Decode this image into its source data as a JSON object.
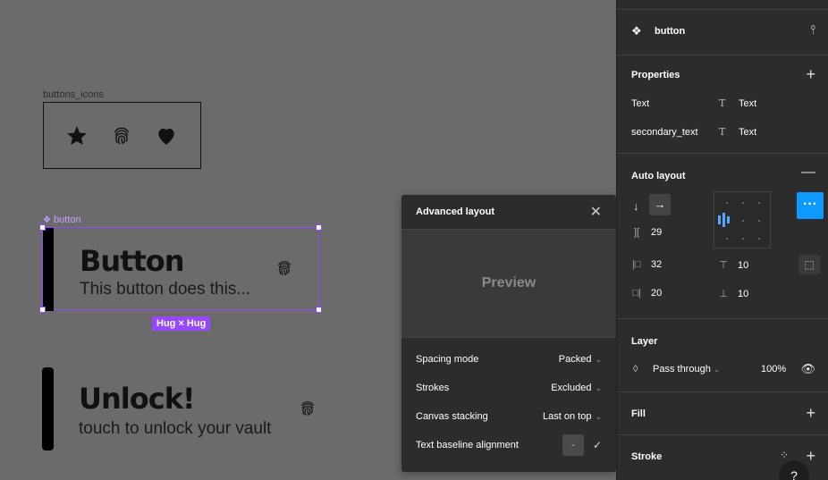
{
  "canvas": {
    "frame_label": "buttons_icons",
    "component_label": "button",
    "button_title": "Button",
    "button_subtitle": "This button does this...",
    "hug_badge": "Hug × Hug",
    "unlock_title": "Unlock!",
    "unlock_subtitle": "touch to unlock your vault"
  },
  "advanced_layout": {
    "title": "Advanced layout",
    "preview": "Preview",
    "rows": [
      {
        "label": "Spacing mode",
        "value": "Packed"
      },
      {
        "label": "Strokes",
        "value": "Excluded"
      },
      {
        "label": "Canvas stacking",
        "value": "Last on top"
      },
      {
        "label": "Text baseline alignment",
        "value": "-"
      }
    ]
  },
  "panel": {
    "component_name": "button",
    "properties": {
      "title": "Properties",
      "items": [
        {
          "name": "Text",
          "value": "Text"
        },
        {
          "name": "secondary_text",
          "value": "Text"
        }
      ]
    },
    "auto_layout": {
      "title": "Auto layout",
      "gap": "29",
      "padding_left": "32",
      "padding_top": "10",
      "padding_right": "20",
      "padding_bottom": "10"
    },
    "layer": {
      "title": "Layer",
      "blend": "Pass through",
      "opacity": "100%"
    },
    "fill_title": "Fill",
    "stroke_title": "Stroke",
    "help": "?"
  },
  "colors": {
    "canvas_bg": "#6b6b6b",
    "panel_bg": "#2c2c2c",
    "selection": "#9747ff",
    "accent_blue": "#0d99ff"
  }
}
